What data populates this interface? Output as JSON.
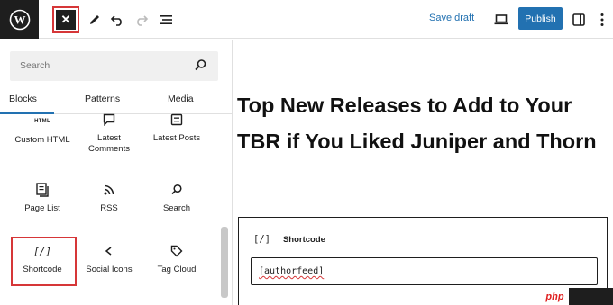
{
  "toolbar": {
    "logo_icon": "wordpress-icon",
    "close_icon": "close-icon",
    "tools": [
      "pencil-icon",
      "undo-icon",
      "redo-icon",
      "list-view-icon"
    ],
    "save_draft_label": "Save draft",
    "preview_icon": "laptop-icon",
    "publish_label": "Publish",
    "settings_icon": "sidebar-toggle-icon",
    "more_icon": "more-vertical-icon",
    "accent_color": "#2271b1",
    "highlight_color": "#d63638"
  },
  "inserter": {
    "search_placeholder": "Search",
    "tabs": [
      {
        "label": "Blocks",
        "active": true
      },
      {
        "label": "Patterns",
        "active": false
      },
      {
        "label": "Media",
        "active": false
      }
    ],
    "partial_label": "HTML",
    "blocks": [
      {
        "label": "Custom HTML",
        "icon": "html-icon"
      },
      {
        "label": "Latest Comments",
        "icon": "comment-icon"
      },
      {
        "label": "Latest Posts",
        "icon": "post-list-icon"
      },
      {
        "label": "Page List",
        "icon": "page-list-icon"
      },
      {
        "label": "RSS",
        "icon": "rss-icon"
      },
      {
        "label": "Search",
        "icon": "search-icon"
      },
      {
        "label": "Shortcode",
        "icon": "shortcode-icon"
      },
      {
        "label": "Social Icons",
        "icon": "share-icon"
      },
      {
        "label": "Tag Cloud",
        "icon": "tag-icon"
      }
    ]
  },
  "editor": {
    "title": "Top New Releases to Add to Your TBR if You Liked Juniper and Thorn",
    "shortcode_block": {
      "icon_text": "[/]",
      "name": "Shortcode",
      "value": "[authorfeed]"
    }
  },
  "watermark": {
    "text": "php"
  }
}
